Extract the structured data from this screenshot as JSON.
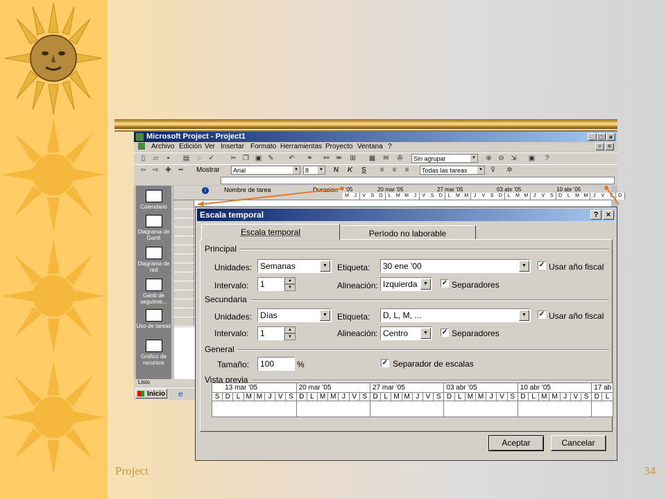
{
  "slide": {
    "footer_left": "Project",
    "page_number": "34"
  },
  "window": {
    "title": "Microsoft Project - Project1",
    "menu": [
      "Archivo",
      "Edición",
      "Ver",
      "Insertar",
      "Formato",
      "Herramientas",
      "Proyecto",
      "Ventana",
      "?"
    ],
    "toolbar": {
      "group_combo": "Sin agrupar",
      "show_label": "Mostrar",
      "font_combo": "Arial",
      "size_combo": "8",
      "bold": "N",
      "italic": "K",
      "underline": "S",
      "filter_combo": "Todas las tareas"
    },
    "viewbar": [
      "Calendario",
      "Diagrama de Gantt",
      "Diagrama de red",
      "Gantt de seguimie...",
      "Uso de tareas",
      "Gráfico de recursos"
    ],
    "columns": {
      "info": "i",
      "name": "Nombre de tarea",
      "duration": "Duración"
    },
    "timeline_weeks": [
      "'05",
      "20 mar '05",
      "27 mar '05",
      "03 abr '05",
      "10 abr '05"
    ],
    "timeline_days": [
      "M",
      "J",
      "V",
      "S",
      "D",
      "L",
      "M",
      "M",
      "J",
      "V",
      "S",
      "D",
      "L",
      "M",
      "M",
      "J",
      "V",
      "S",
      "D",
      "L",
      "M",
      "M",
      "J",
      "V",
      "S",
      "D",
      "L",
      "M",
      "M",
      "J",
      "V",
      "S",
      "D"
    ],
    "status": "Listo",
    "start_button": "Inicio"
  },
  "dialog": {
    "title": "Escala temporal",
    "help_btn": "?",
    "close_btn": "×",
    "tabs": [
      "Escala temporal",
      "Período no laborable"
    ],
    "principal": {
      "section": "Principal",
      "units_label": "Unidades:",
      "units_value": "Semanas",
      "label_label": "Etiqueta:",
      "label_value": "30 ene '00",
      "fiscal_label": "Usar año fiscal",
      "interval_label": "Intervalo:",
      "interval_value": "1",
      "align_label": "Alineación:",
      "align_value": "Izquierda",
      "separators_label": "Separadores"
    },
    "secundaria": {
      "section": "Secundaria",
      "units_label": "Unidades:",
      "units_value": "Días",
      "label_label": "Etiqueta:",
      "label_value": "D, L, M, ...",
      "fiscal_label": "Usar año fiscal",
      "interval_label": "Intervalo:",
      "interval_value": "1",
      "align_label": "Alineación:",
      "align_value": "Centro",
      "separators_label": "Separadores"
    },
    "general": {
      "section": "General",
      "size_label": "Tamaño:",
      "size_value": "100",
      "size_unit": "%",
      "scale_sep_label": "Separador de escalas"
    },
    "preview": {
      "section": "Vista previa",
      "weeks": [
        "13 mar '05",
        "20 mar '05",
        "27 mar '05",
        "03 abr '05",
        "10 abr '05",
        "17 ab"
      ],
      "days": [
        "S",
        "D",
        "L",
        "M",
        "M",
        "J",
        "V",
        "S",
        "D",
        "L",
        "M",
        "M",
        "J",
        "V",
        "S",
        "D",
        "L",
        "M",
        "M",
        "J",
        "V",
        "S",
        "D",
        "L",
        "M",
        "M",
        "J",
        "V",
        "S",
        "D",
        "L",
        "M",
        "M",
        "J",
        "V",
        "S",
        "D",
        "L"
      ]
    },
    "ok_label": "Aceptar",
    "cancel_label": "Cancelar"
  },
  "colors": {
    "left_strip": "#ffcc66",
    "sun": "#f5b83d",
    "title_bar": "#0a246a",
    "arrow": "#e07a30",
    "footer_text": "#c79a3c"
  }
}
